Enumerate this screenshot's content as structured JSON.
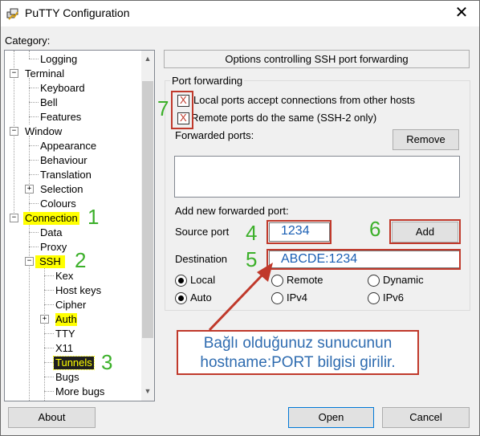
{
  "window": {
    "title": "PuTTY Configuration",
    "close_glyph": "✕"
  },
  "category": {
    "label": "Category:",
    "items": [
      {
        "label": "Logging"
      },
      {
        "label": "Terminal"
      },
      {
        "label": "Keyboard"
      },
      {
        "label": "Bell"
      },
      {
        "label": "Features"
      },
      {
        "label": "Window"
      },
      {
        "label": "Appearance"
      },
      {
        "label": "Behaviour"
      },
      {
        "label": "Translation"
      },
      {
        "label": "Selection"
      },
      {
        "label": "Colours"
      },
      {
        "label": "Connection"
      },
      {
        "label": "Data"
      },
      {
        "label": "Proxy"
      },
      {
        "label": "SSH"
      },
      {
        "label": "Kex"
      },
      {
        "label": "Host keys"
      },
      {
        "label": "Cipher"
      },
      {
        "label": "Auth"
      },
      {
        "label": "TTY"
      },
      {
        "label": "X11"
      },
      {
        "label": "Tunnels"
      },
      {
        "label": "Bugs"
      },
      {
        "label": "More bugs"
      }
    ],
    "selected": "Tunnels"
  },
  "panel": {
    "header": "Options controlling SSH port forwarding",
    "group_title": "Port forwarding",
    "check_local": {
      "label": "Local ports accept connections from other hosts",
      "checked": "X"
    },
    "check_remote": {
      "label": "Remote ports do the same (SSH-2 only)",
      "checked": "X"
    },
    "forwarded_ports_label": "Forwarded ports:",
    "remove_label": "Remove",
    "add_new_label": "Add new forwarded port:",
    "source_port_label": "Source port",
    "source_port_value": "1234",
    "add_label": "Add",
    "destination_label": "Destination",
    "destination_value": "ABCDE:1234",
    "radios_row1": [
      {
        "label": "Local",
        "selected": true
      },
      {
        "label": "Remote",
        "selected": false
      },
      {
        "label": "Dynamic",
        "selected": false
      }
    ],
    "radios_row2": [
      {
        "label": "Auto",
        "selected": true
      },
      {
        "label": "IPv4",
        "selected": false
      },
      {
        "label": "IPv6",
        "selected": false
      }
    ]
  },
  "buttons": {
    "about": "About",
    "open": "Open",
    "cancel": "Cancel"
  },
  "annotations": {
    "n1": "1",
    "n2": "2",
    "n3": "3",
    "n4": "4",
    "n5": "5",
    "n6": "6",
    "n7": "7",
    "callout_line1": "Bağlı olduğunuz sunucunun",
    "callout_line2": "hostname:PORT bilgisi girilir.",
    "accent_red": "#c0392b",
    "accent_green": "#3cb02a",
    "highlight_yellow": "#ffff00"
  },
  "icons": {
    "app": "putty-icon",
    "close": "close-icon"
  }
}
